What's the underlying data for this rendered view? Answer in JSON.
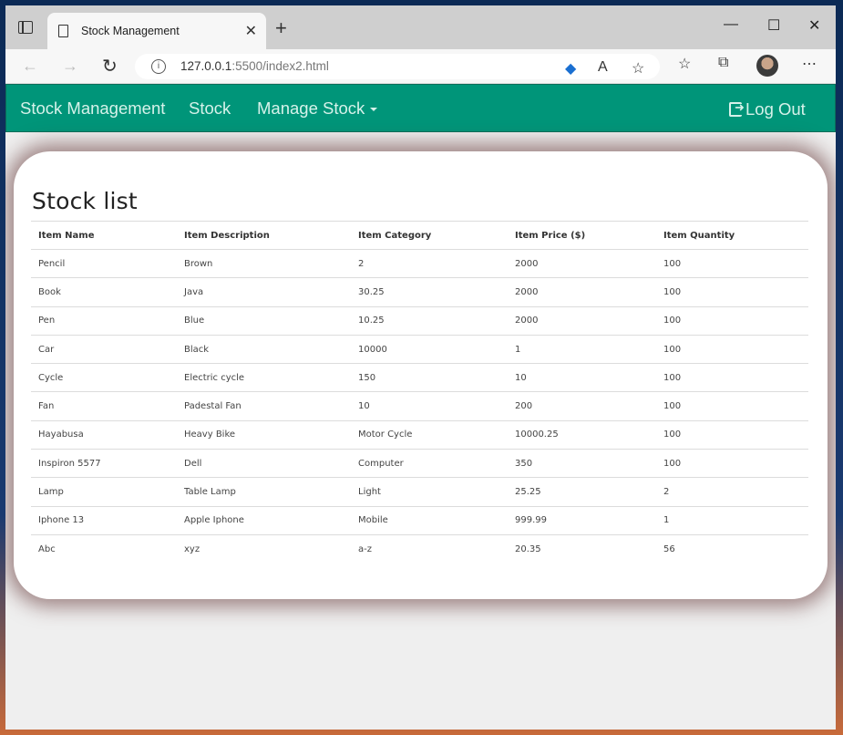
{
  "browser": {
    "tab_title": "Stock Management",
    "url_host": "127.0.0.1",
    "url_rest": ":5500/index2.html"
  },
  "navbar": {
    "brand": "Stock Management",
    "stock": "Stock",
    "manage_stock": "Manage Stock",
    "logout": "Log Out"
  },
  "main": {
    "title": "Stock list",
    "columns": [
      "Item Name",
      "Item Description",
      "Item Category",
      "Item Price ($)",
      "Item Quantity"
    ],
    "rows": [
      [
        "Pencil",
        "Brown",
        "2",
        "2000",
        "100"
      ],
      [
        "Book",
        "Java",
        "30.25",
        "2000",
        "100"
      ],
      [
        "Pen",
        "Blue",
        "10.25",
        "2000",
        "100"
      ],
      [
        "Car",
        "Black",
        "10000",
        "1",
        "100"
      ],
      [
        "Cycle",
        "Electric cycle",
        "150",
        "10",
        "100"
      ],
      [
        "Fan",
        "Padestal Fan",
        "10",
        "200",
        "100"
      ],
      [
        "Hayabusa",
        "Heavy Bike",
        "Motor Cycle",
        "10000.25",
        "100"
      ],
      [
        "Inspiron 5577",
        "Dell",
        "Computer",
        "350",
        "100"
      ],
      [
        "Lamp",
        "Table Lamp",
        "Light",
        "25.25",
        "2"
      ],
      [
        "Iphone 13",
        "Apple Iphone",
        "Mobile",
        "999.99",
        "1"
      ],
      [
        "Abc",
        "xyz",
        "a-z",
        "20.35",
        "56"
      ]
    ]
  }
}
